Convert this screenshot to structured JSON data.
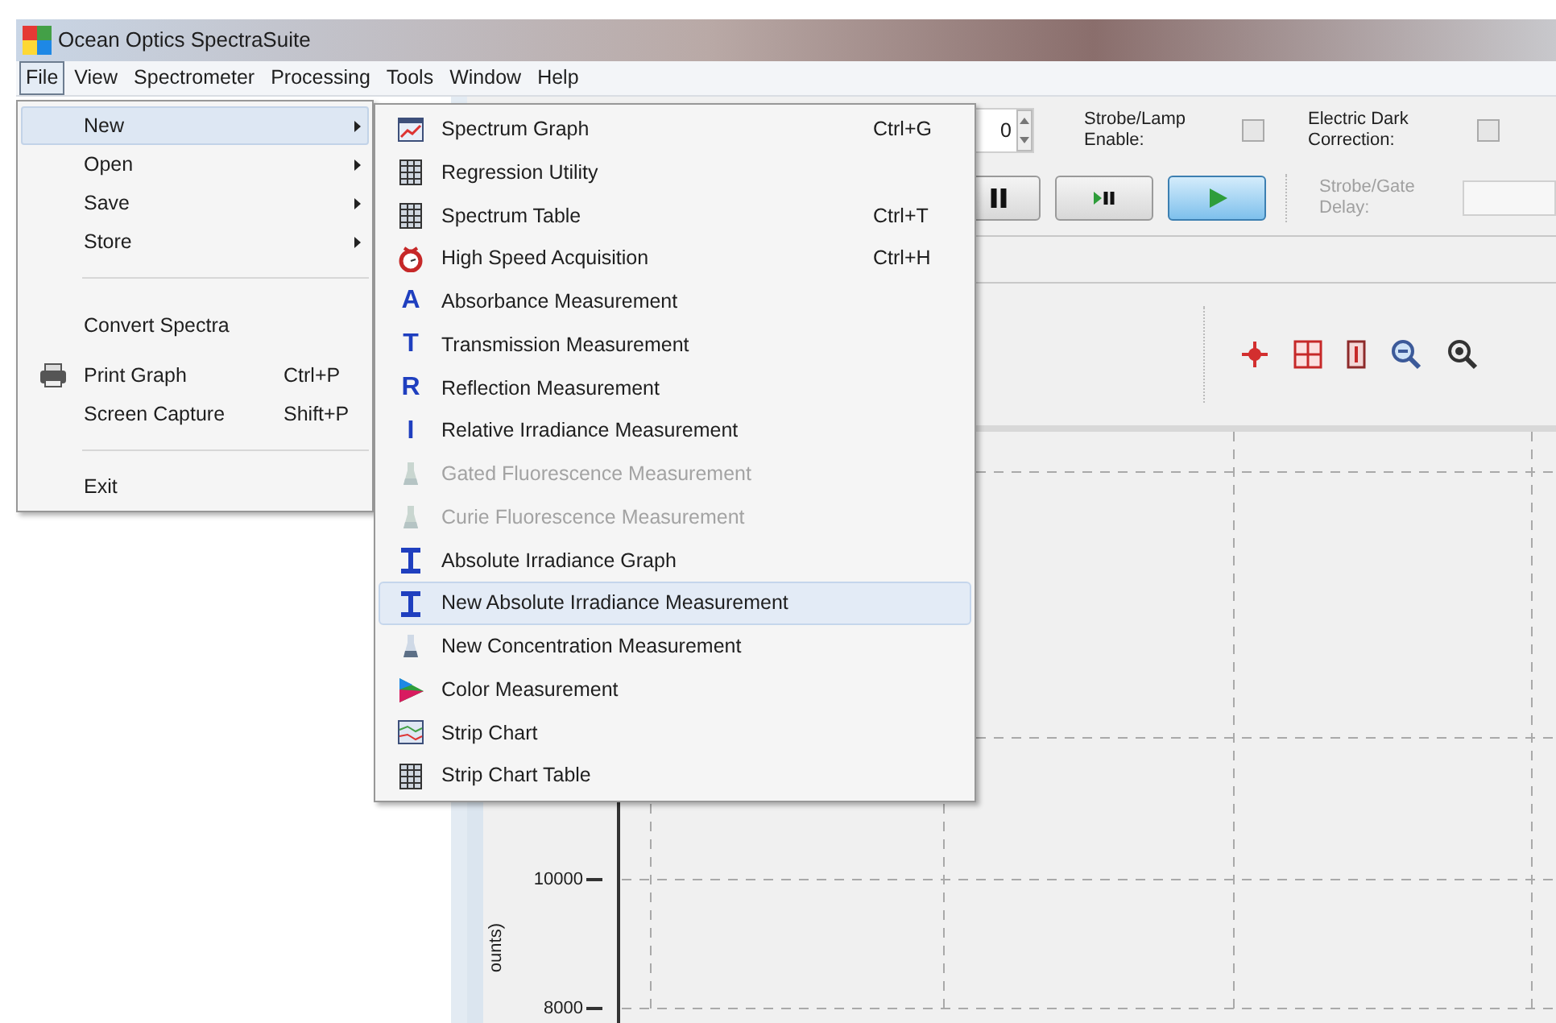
{
  "window": {
    "title": "Ocean Optics SpectraSuite"
  },
  "menu_bar": [
    {
      "label": "File",
      "selected": true
    },
    {
      "label": "View",
      "selected": false
    },
    {
      "label": "Spectrometer",
      "selected": false
    },
    {
      "label": "Processing",
      "selected": false
    },
    {
      "label": "Tools",
      "selected": false
    },
    {
      "label": "Window",
      "selected": false
    },
    {
      "label": "Help",
      "selected": false
    }
  ],
  "file_menu": [
    {
      "kind": "submenu",
      "label": "New",
      "selected": true
    },
    {
      "kind": "submenu",
      "label": "Open",
      "selected": false
    },
    {
      "kind": "submenu",
      "label": "Save",
      "selected": false
    },
    {
      "kind": "submenu",
      "label": "Store",
      "selected": false
    },
    {
      "kind": "separator"
    },
    {
      "kind": "item",
      "label": "Convert Spectra",
      "selected": false
    },
    {
      "kind": "print",
      "label": "Print Graph",
      "shortcut": "Ctrl+P",
      "selected": false
    },
    {
      "kind": "item",
      "label": "Screen Capture",
      "shortcut": "Shift+P",
      "selected": false
    },
    {
      "kind": "separator"
    },
    {
      "kind": "item",
      "label": "Exit",
      "selected": false
    }
  ],
  "new_submenu": [
    {
      "kind": "graph",
      "label": "Spectrum Graph",
      "shortcut": "Ctrl+G",
      "disabled": false,
      "selected": false
    },
    {
      "kind": "table",
      "label": "Regression Utility",
      "disabled": false,
      "selected": false
    },
    {
      "kind": "table",
      "label": "Spectrum Table",
      "shortcut": "Ctrl+T",
      "disabled": false,
      "selected": false
    },
    {
      "kind": "stopwatch",
      "label": "High Speed Acquisition",
      "shortcut": "Ctrl+H",
      "disabled": false,
      "selected": false
    },
    {
      "kind": "letter",
      "glyph": "A",
      "label": "Absorbance Measurement",
      "disabled": false,
      "selected": false
    },
    {
      "kind": "letter",
      "glyph": "T",
      "label": "Transmission Measurement",
      "disabled": false,
      "selected": false
    },
    {
      "kind": "letter",
      "glyph": "R",
      "label": "Reflection Measurement",
      "disabled": false,
      "selected": false
    },
    {
      "kind": "letter",
      "glyph": "I",
      "label": "Relative Irradiance Measurement",
      "disabled": false,
      "selected": false
    },
    {
      "kind": "flask",
      "label": "Gated Fluorescence Measurement",
      "disabled": true,
      "selected": false
    },
    {
      "kind": "flask",
      "label": "Curie Fluorescence Measurement",
      "disabled": true,
      "selected": false
    },
    {
      "kind": "ibeam",
      "label": "Absolute Irradiance Graph",
      "disabled": false,
      "selected": false
    },
    {
      "kind": "ibeam",
      "label": "New Absolute Irradiance Measurement",
      "disabled": false,
      "selected": true
    },
    {
      "kind": "flask",
      "label": "New Concentration Measurement",
      "disabled": false,
      "selected": false
    },
    {
      "kind": "color",
      "label": "Color Measurement",
      "disabled": false,
      "selected": false
    },
    {
      "kind": "stripchart",
      "label": "Strip Chart",
      "disabled": false,
      "selected": false
    },
    {
      "kind": "table",
      "label": "Strip Chart Table",
      "disabled": false,
      "selected": false
    }
  ],
  "toolbar": {
    "spinner_value": "0",
    "strobe_lamp_label": "Strobe/Lamp Enable:",
    "strobe_lamp_checked": false,
    "dark_correction_label": "Electric Dark Correction:",
    "dark_correction_checked": false,
    "buttons": [
      {
        "kind": "pause",
        "selected": false
      },
      {
        "kind": "step",
        "selected": false
      },
      {
        "kind": "play",
        "selected": true
      }
    ],
    "strobe_gate_label": "Strobe/Gate Delay:"
  },
  "graph": {
    "y_ticks": [
      "10000",
      "8000"
    ],
    "y_axis_label": "ounts)"
  }
}
